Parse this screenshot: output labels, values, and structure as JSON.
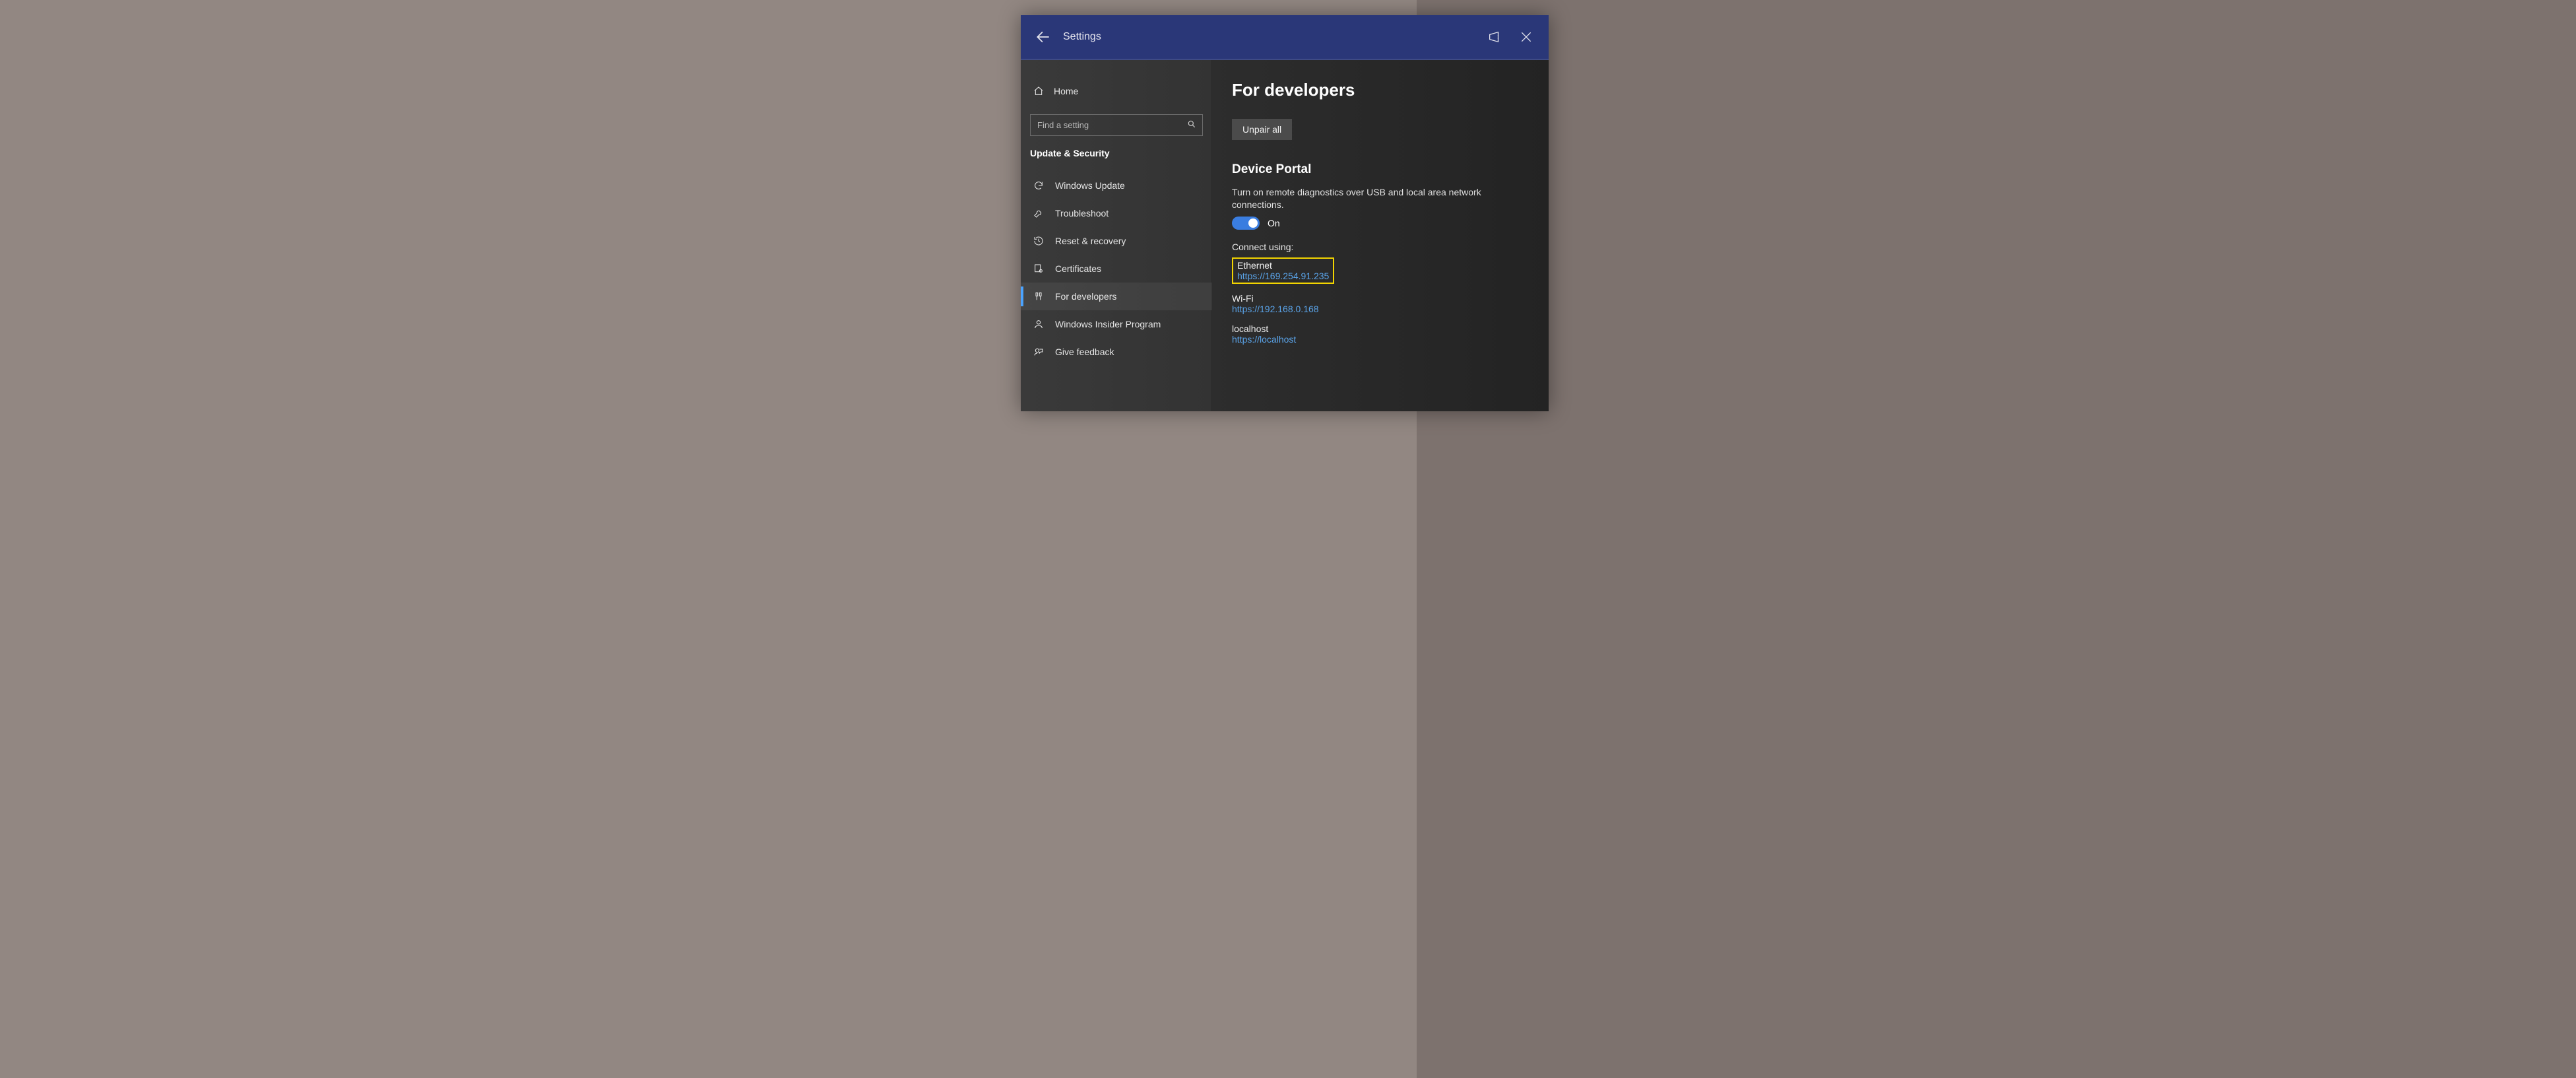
{
  "title": "Settings",
  "sidebar": {
    "home": "Home",
    "search_placeholder": "Find a setting",
    "section": "Update & Security",
    "items": [
      {
        "label": "Windows Update"
      },
      {
        "label": "Troubleshoot"
      },
      {
        "label": "Reset & recovery"
      },
      {
        "label": "Certificates"
      },
      {
        "label": "For developers"
      },
      {
        "label": "Windows Insider Program"
      },
      {
        "label": "Give feedback"
      }
    ]
  },
  "main": {
    "heading": "For developers",
    "unpair_label": "Unpair all",
    "portal_heading": "Device Portal",
    "portal_desc": "Turn on remote diagnostics over USB and local area network connections.",
    "toggle_state": "On",
    "connect_label": "Connect using:",
    "connections": [
      {
        "name": "Ethernet",
        "url": "https://169.254.91.235",
        "hl": true
      },
      {
        "name": "Wi-Fi",
        "url": "https://192.168.0.168"
      },
      {
        "name": "localhost",
        "url": "https://localhost"
      }
    ]
  }
}
